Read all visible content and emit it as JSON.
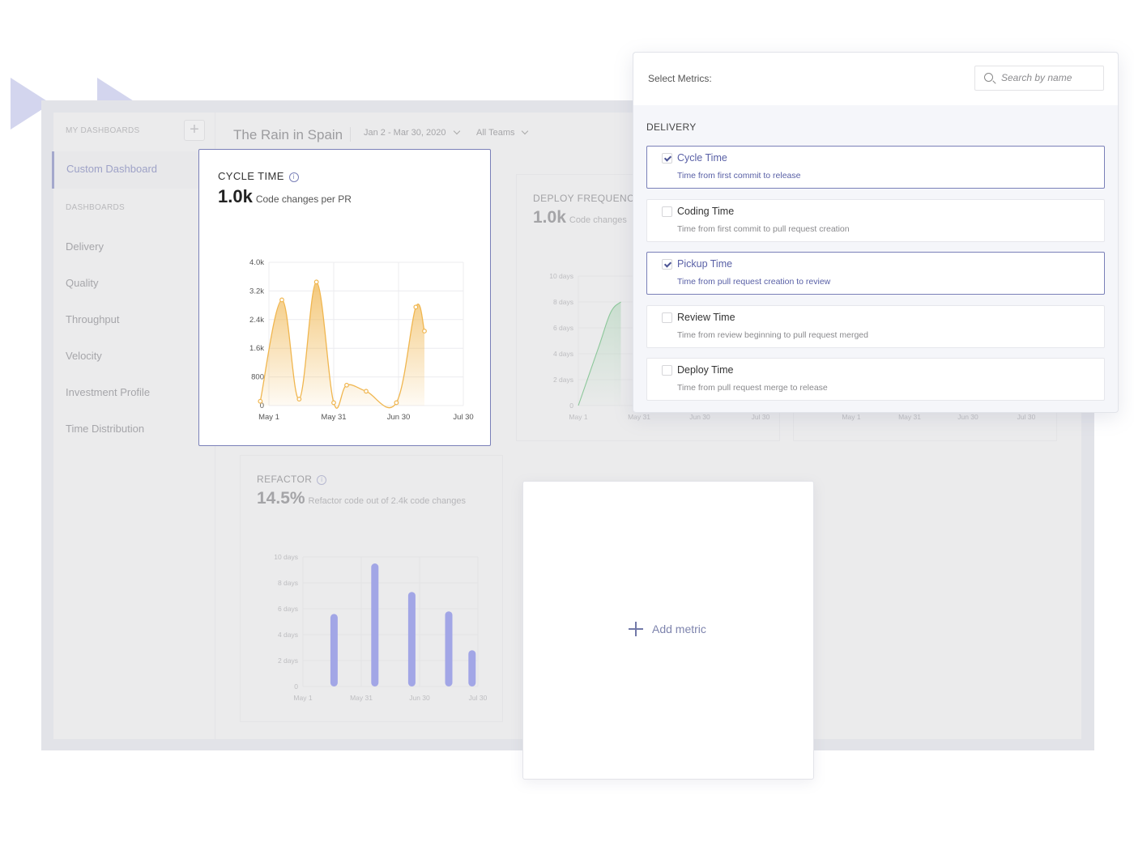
{
  "sidebar": {
    "my_dashboards_label": "MY DASHBOARDS",
    "add_button": "+",
    "active_item": "Custom Dashboard",
    "dashboards_label": "DASHBOARDS",
    "items": [
      {
        "label": "Delivery"
      },
      {
        "label": "Quality"
      },
      {
        "label": "Throughput"
      },
      {
        "label": "Velocity"
      },
      {
        "label": "Investment Profile"
      },
      {
        "label": "Time Distribution"
      }
    ]
  },
  "topbar": {
    "title": "The Rain in Spain",
    "date_range": "Jan 2 - Mar 30, 2020",
    "team_filter": "All Teams"
  },
  "cards": {
    "cycle_time": {
      "title": "CYCLE TIME",
      "value": "1.0k",
      "subtitle": "Code changes per PR",
      "info_icon": "info-icon"
    },
    "deploy_frequency": {
      "title": "DEPLOY FREQUENCY",
      "value": "1.0k",
      "subtitle": "Code changes"
    },
    "refactor": {
      "title": "REFACTOR",
      "value": "14.5%",
      "subtitle": "Refactor code out of 2.4k code changes",
      "info_icon": "info-icon"
    },
    "add_metric": {
      "label": "Add metric",
      "icon": "plus-icon"
    }
  },
  "metrics_panel": {
    "label": "Select Metrics:",
    "search_placeholder": "Search by name",
    "section": "DELIVERY",
    "items": [
      {
        "name": "Cycle Time",
        "description": "Time from first commit to release",
        "checked": true
      },
      {
        "name": "Coding Time",
        "description": "Time from first commit to pull request creation",
        "checked": false
      },
      {
        "name": "Pickup Time",
        "description": "Time from pull request creation to review",
        "checked": true
      },
      {
        "name": "Review Time",
        "description": "Time from review beginning to pull request merged",
        "checked": false
      },
      {
        "name": "Deploy Time",
        "description": "Time from pull request merge to release",
        "checked": false
      }
    ]
  },
  "colors": {
    "accent": "#7a80b8",
    "cycle_line": "#f0b64f",
    "deploy_line": "#8cc79a",
    "refactor_bar": "#a2a6e6"
  },
  "chart_data": [
    {
      "id": "cycle_time",
      "type": "area",
      "title": "CYCLE TIME",
      "x_ticks": [
        "May 1",
        "May 31",
        "Jun 30",
        "Jul 30"
      ],
      "y_ticks": [
        "0",
        "800",
        "1.6k",
        "2.4k",
        "3.2k",
        "4.0k"
      ],
      "ylim": [
        0,
        4000
      ],
      "xlim": [
        0,
        90
      ],
      "x": [
        -4,
        6,
        14,
        22,
        30,
        36,
        45,
        59,
        68,
        72
      ],
      "values": [
        120,
        2950,
        180,
        3450,
        80,
        570,
        400,
        80,
        2750,
        2080
      ],
      "grid": true
    },
    {
      "id": "deploy_frequency",
      "type": "area",
      "title": "DEPLOY FREQUENCY",
      "x_ticks": [
        "May 1",
        "May 31",
        "Jun 30",
        "Jul 30"
      ],
      "y_ticks": [
        "0",
        "2 days",
        "4 days",
        "6 days",
        "8 days",
        "10 days"
      ],
      "ylim": [
        0,
        10
      ],
      "xlim": [
        0,
        90
      ],
      "x": [
        0,
        10,
        16,
        21
      ],
      "values": [
        0,
        4.5,
        7.2,
        8.0
      ],
      "grid": true
    },
    {
      "id": "hidden_chart",
      "type": "line",
      "x_ticks": [
        "May 1",
        "May 31",
        "Jun 30",
        "Jul 30"
      ]
    },
    {
      "id": "refactor",
      "type": "bar",
      "title": "REFACTOR",
      "x_ticks": [
        "May 1",
        "May 31",
        "Jun 30",
        "Jul 30"
      ],
      "y_ticks": [
        "0",
        "2 days",
        "4 days",
        "6 days",
        "8 days",
        "10 days"
      ],
      "ylim": [
        0,
        10
      ],
      "xlim": [
        0,
        90
      ],
      "x": [
        16,
        37,
        56,
        75,
        87
      ],
      "values": [
        5.6,
        9.5,
        7.3,
        5.8,
        2.8
      ],
      "grid": true
    }
  ]
}
